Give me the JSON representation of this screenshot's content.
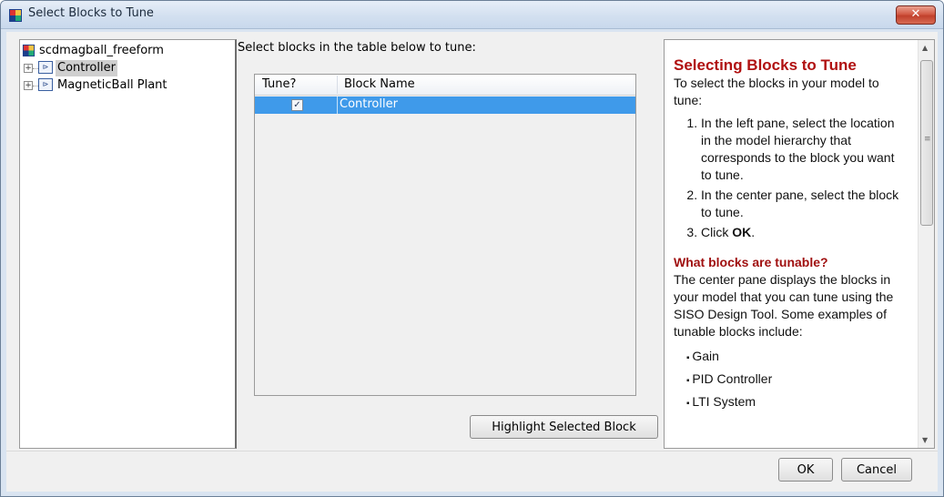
{
  "window": {
    "title": "Select Blocks to Tune",
    "close_glyph": "✕"
  },
  "tree": {
    "root_label": "scdmagball_freeform",
    "items": [
      {
        "label": "Controller",
        "selected": true
      },
      {
        "label": "MagneticBall Plant",
        "selected": false
      }
    ]
  },
  "center": {
    "instruction": "Select blocks in the table below to tune:",
    "columns": [
      "Tune?",
      "Block Name"
    ],
    "rows": [
      {
        "tune": true,
        "name": "Controller",
        "selected": true
      }
    ],
    "highlight_button": "Highlight Selected Block"
  },
  "help": {
    "title": "Selecting Blocks to Tune",
    "intro": "To select the blocks in your model to tune:",
    "steps": [
      "In the left pane, select the location in the model hierarchy that corresponds to the block you want to tune.",
      "In the center pane, select the block to tune."
    ],
    "step3_prefix": "Click ",
    "step3_bold": "OK",
    "step3_suffix": ".",
    "subtitle": "What blocks are tunable?",
    "tunable_text": "The center pane displays the blocks in your model that you can tune using the SISO Design Tool. Some examples of tunable blocks include:",
    "examples": [
      "Gain",
      "PID Controller",
      "LTI System"
    ]
  },
  "buttons": {
    "ok": "OK",
    "cancel": "Cancel"
  },
  "colors": {
    "selection": "#3f9aea",
    "help_heading": "#b01010",
    "title_bar": "#d3e0f0"
  },
  "icons": [
    "model-icon",
    "expand-plus-icon",
    "subsystem-block-icon",
    "checkbox-checked-icon",
    "scroll-up-icon",
    "scroll-down-icon"
  ]
}
